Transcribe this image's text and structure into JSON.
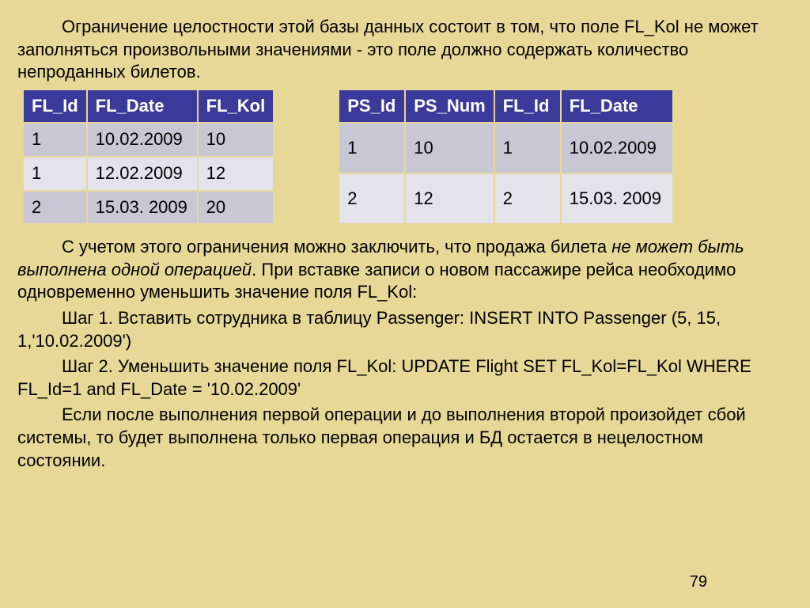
{
  "intro": "Ограничение целостности этой базы данных состоит в том, что поле FL_Kol не может заполняться произвольными значениями - это поле должно содержать количество непроданных билетов.",
  "tableLeft": {
    "headers": [
      "FL_Id",
      "FL_Date",
      "FL_Kol"
    ],
    "rows": [
      [
        "1",
        "10.02.2009",
        "10"
      ],
      [
        "1",
        "12.02.2009",
        "12"
      ],
      [
        "2",
        "15.03. 2009",
        "20"
      ]
    ]
  },
  "tableRight": {
    "headers": [
      "PS_Id",
      "PS_Num",
      "FL_Id",
      "FL_Date"
    ],
    "rows": [
      [
        "1",
        "10",
        "1",
        "10.02.2009"
      ],
      [
        "2",
        "12",
        "2",
        "15.03. 2009"
      ]
    ]
  },
  "body": {
    "p1_a": "С учетом этого ограничения можно заключить, что продажа билета ",
    "p1_em": "не может быть выполнена одной операцией",
    "p1_b": ". При вставке записи о новом пассажире рейса необходимо одновременно уменьшить значение поля FL_Kol:",
    "p2": "Шаг 1. Вставить сотрудника в таблицу Passenger: INSERT INTO Passenger (5, 15, 1,'10.02.2009')",
    "p3": "Шаг 2. Уменьшить значение поля FL_Kol: UPDATE Flight SET FL_Kol=FL_Kol  WHERE  FL_Id=1 and FL_Date = '10.02.2009'",
    "p4": "Если после выполнения первой операции и до выполнения второй произойдет сбой системы, то будет выполнена только первая операция и БД остается в нецелостном состоянии."
  },
  "pageNum": "79"
}
